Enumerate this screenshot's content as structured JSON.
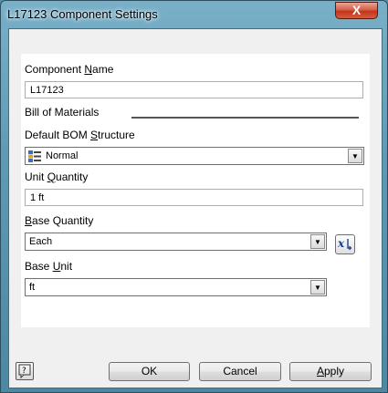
{
  "window": {
    "title": "L17123 Component Settings",
    "close_label": "X"
  },
  "fields": {
    "component_name": {
      "label_pre": "Component ",
      "label_accel": "N",
      "label_post": "ame",
      "value": "L17123"
    },
    "bill_of_materials": {
      "label": "Bill of Materials"
    },
    "bom_structure": {
      "label_pre": "Default BOM ",
      "label_accel": "S",
      "label_post": "tructure",
      "value": "Normal",
      "icon": "bom-structure-icon"
    },
    "unit_quantity": {
      "label_pre": "Unit ",
      "label_accel": "Q",
      "label_post": "uantity",
      "value": "1 ft"
    },
    "base_quantity": {
      "label_pre": "",
      "label_accel": "B",
      "label_post": "ase Quantity",
      "value": "Each",
      "fx_icon": "parameter-fx-icon"
    },
    "base_unit": {
      "label_pre": "Base ",
      "label_accel": "U",
      "label_post": "nit",
      "value": "ft"
    }
  },
  "buttons": {
    "ok": "OK",
    "cancel": "Cancel",
    "apply_accel": "A",
    "apply_rest": "pply",
    "help_icon": "help-icon"
  },
  "colors": {
    "title_bar": "#5f9ab4",
    "close_button": "#c1351b"
  }
}
